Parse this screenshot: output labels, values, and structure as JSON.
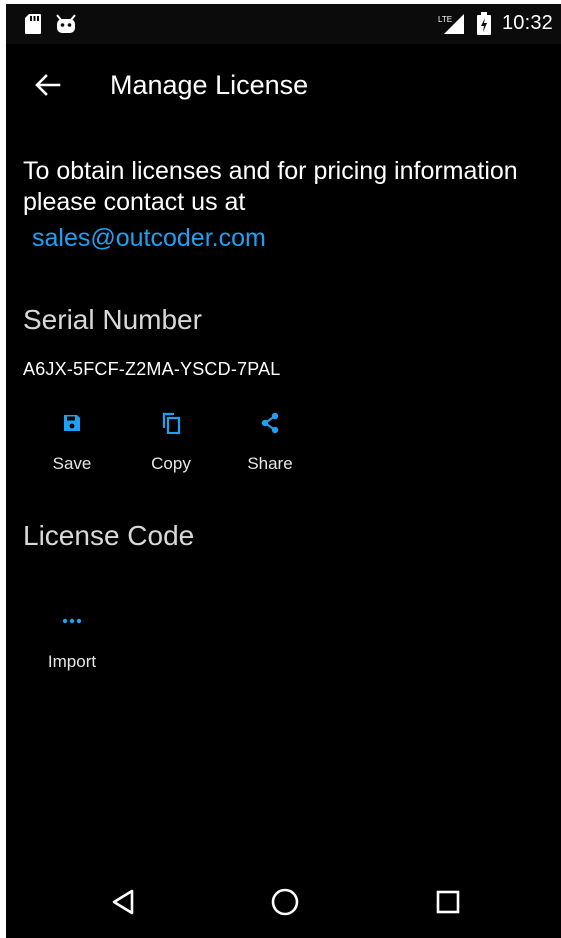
{
  "status_bar": {
    "left_icons": [
      "sd-card-icon",
      "android-icon"
    ],
    "right_icons": [
      "lte-signal-icon",
      "battery-icon"
    ],
    "time": "10:32"
  },
  "app_bar": {
    "back_icon": "back-arrow-icon",
    "title": "Manage License"
  },
  "info": {
    "text": "To obtain licenses and for pricing information please contact us at",
    "email": "sales@outcoder.com"
  },
  "serial": {
    "title": "Serial Number",
    "value": "A6JX-5FCF-Z2MA-YSCD-7PAL",
    "actions": [
      {
        "label": "Save",
        "icon": "save-icon"
      },
      {
        "label": "Copy",
        "icon": "copy-icon"
      },
      {
        "label": "Share",
        "icon": "share-icon"
      }
    ]
  },
  "license": {
    "title": "License Code",
    "actions": [
      {
        "label": "Import",
        "icon": "more-horizontal-icon"
      }
    ]
  },
  "nav_bar": {
    "icons": [
      "nav-back-icon",
      "nav-home-icon",
      "nav-recents-icon"
    ]
  },
  "colors": {
    "accent": "#1ea1f2",
    "background": "#000000",
    "text": "#ffffff"
  }
}
